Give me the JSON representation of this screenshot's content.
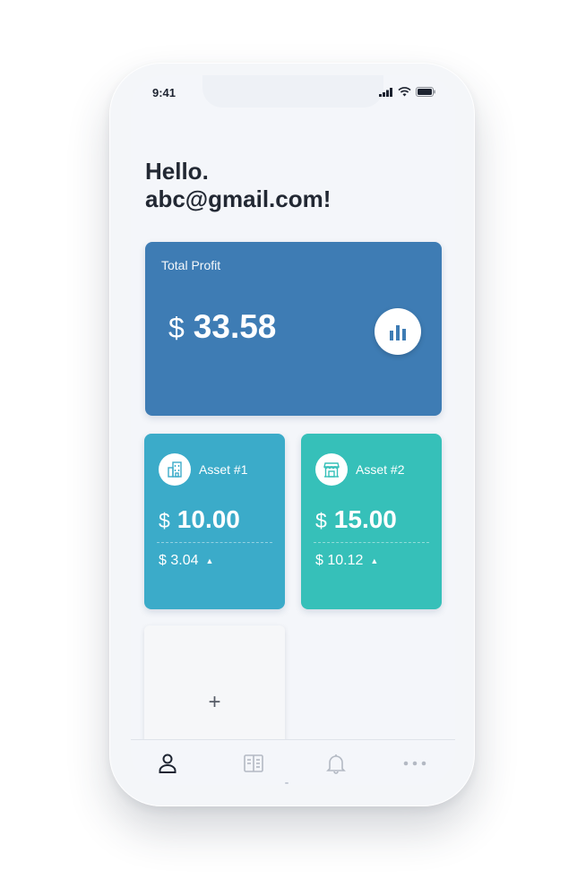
{
  "status_bar": {
    "time": "9:41"
  },
  "greeting": {
    "line1": "Hello.",
    "line2": "abc@gmail.com!"
  },
  "total_profit": {
    "label": "Total Profit",
    "currency": "$",
    "value": "33.58"
  },
  "assets": [
    {
      "name": "Asset #1",
      "currency": "$",
      "value": "10.00",
      "change": "$ 3.04",
      "trend": "up",
      "color": "#3babc9",
      "icon": "building-icon"
    },
    {
      "name": "Asset #2",
      "currency": "$",
      "value": "15.00",
      "change": "$ 10.12",
      "trend": "up",
      "color": "#36c0b9",
      "icon": "store-icon"
    }
  ],
  "add_card": {
    "label": "+"
  },
  "tabbar": {
    "items": [
      {
        "icon": "user-icon",
        "active": true
      },
      {
        "icon": "book-icon",
        "active": false
      },
      {
        "icon": "bell-icon",
        "active": false
      },
      {
        "icon": "more-icon",
        "active": false
      }
    ]
  },
  "colors": {
    "accent_blue": "#3e7cb4",
    "asset1": "#3babc9",
    "asset2": "#36c0b9",
    "background": "#f4f6fa"
  }
}
